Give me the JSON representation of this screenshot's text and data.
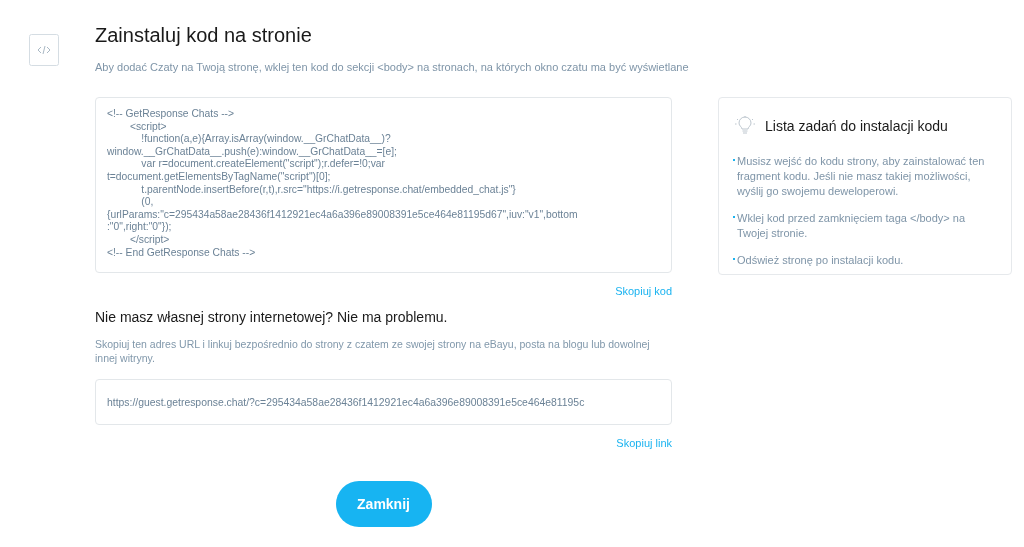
{
  "title": "Zainstaluj kod na stronie",
  "subtitle": "Aby dodać Czaty na Twoją stronę, wklej ten kod do sekcji <body> na stronach, na których okno czatu ma być wyświetlane",
  "code": "<!-- GetResponse Chats -->\n        <script>\n            !function(a,e){Array.isArray(window.__GrChatData__)?\nwindow.__GrChatData__.push(e):window.__GrChatData__=[e];\n            var r=document.createElement(\"script\");r.defer=!0;var\nt=document.getElementsByTagName(\"script\")[0];\n            t.parentNode.insertBefore(r,t),r.src=\"https://i.getresponse.chat/embedded_chat.js\"}\n            (0,\n{urlParams:\"c=295434a58ae28436f1412921ec4a6a396e89008391e5ce464e81195d67\",iuv:\"v1\",bottom\n:\"0\",right:\"0\"});\n        </script>\n<!-- End GetResponse Chats -->",
  "copy_code": "Skopiuj kod",
  "no_site_heading": "Nie masz własnej strony internetowej? Nie ma problemu.",
  "no_site_text": "Skopiuj ten adres URL i linkuj bezpośrednio do strony z czatem ze swojej strony na eBayu, posta na blogu lub dowolnej innej witryny.",
  "url": "https://guest.getresponse.chat/?c=295434a58ae28436f1412921ec4a6a396e89008391e5ce464e81195c",
  "copy_link": "Skopiuj link",
  "checklist": {
    "title": "Lista zadań do instalacji kodu",
    "items": [
      "Musisz wejść do kodu strony, aby zainstalować ten fragment kodu. Jeśli nie masz takiej możliwości, wyślij go swojemu deweloperowi.",
      "Wklej kod przed zamknięciem taga </body> na Twojej stronie.",
      "Odśwież stronę po instalacji kodu."
    ]
  },
  "close_button": "Zamknij"
}
